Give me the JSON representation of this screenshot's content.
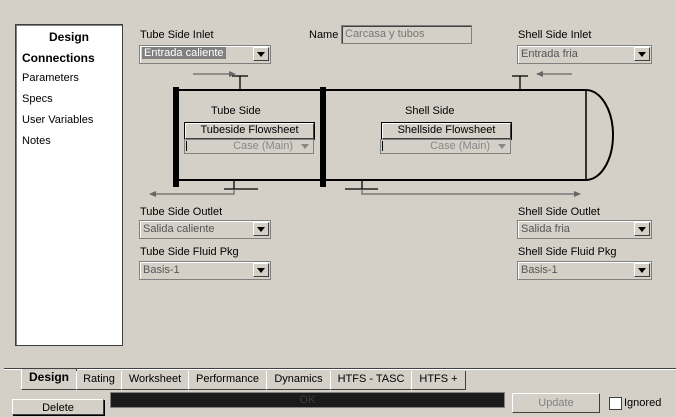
{
  "nav": {
    "title": "Design",
    "items": [
      "Connections",
      "Parameters",
      "Specs",
      "User Variables",
      "Notes"
    ]
  },
  "tube_inlet": {
    "label": "Tube Side Inlet",
    "value": "Entrada caliente"
  },
  "name": {
    "label": "Name",
    "value": "Carcasa y tubos"
  },
  "shell_inlet": {
    "label": "Shell Side Inlet",
    "value": "Entrada fria"
  },
  "tube_side": {
    "label": "Tube Side",
    "flowsheet": "Tubeside Flowsheet",
    "case": "Case (Main)"
  },
  "shell_side": {
    "label": "Shell Side",
    "flowsheet": "Shellside Flowsheet",
    "case": "Case (Main)"
  },
  "tube_outlet": {
    "label": "Tube Side Outlet",
    "value": "Salida caliente"
  },
  "shell_outlet": {
    "label": "Shell Side Outlet",
    "value": "Salida fria"
  },
  "tube_pkg": {
    "label": "Tube Side Fluid Pkg",
    "value": "Basis-1"
  },
  "shell_pkg": {
    "label": "Shell Side Fluid Pkg",
    "value": "Basis-1"
  },
  "tabs": [
    "Design",
    "Rating",
    "Worksheet",
    "Performance",
    "Dynamics",
    "HTFS - TASC",
    "HTFS +"
  ],
  "bottom": {
    "delete": "Delete",
    "status": "OK",
    "update": "Update",
    "ignored": "Ignored"
  },
  "colors": {
    "status_bar": "#1a1a1a",
    "status_text": "#3b3b3b"
  }
}
